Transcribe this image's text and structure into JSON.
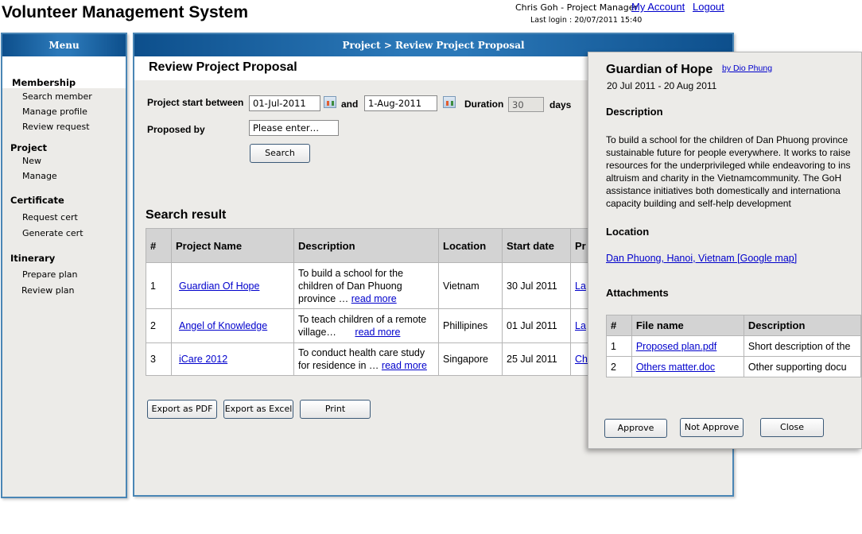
{
  "header": {
    "app_title": "Volunteer Management System",
    "user_info": "Chris Goh - Project Manager",
    "my_account": "My Account",
    "logout": "Logout",
    "last_login": "Last login : 20/07/2011 15:40"
  },
  "sidebar": {
    "title": "Menu",
    "groups": [
      {
        "label": "Membership",
        "items": [
          "Search member",
          "Manage profile",
          "Review request"
        ]
      },
      {
        "label": "Project",
        "items": [
          "New",
          "Manage"
        ]
      },
      {
        "label": "Certificate",
        "items": [
          "Request cert",
          "Generate cert"
        ]
      },
      {
        "label": "Itinerary",
        "items": [
          "Prepare plan",
          "Review plan"
        ]
      }
    ]
  },
  "main": {
    "panel_title": "Project > Review Project Proposal",
    "page_title": "Review Project Proposal",
    "form": {
      "start_between_label": "Project start between",
      "start_from": "01-Jul-2011",
      "and_label": "and",
      "start_to": "1-Aug-2011",
      "duration_label": "Duration",
      "duration_value": "30",
      "days_label": "days",
      "proposed_by_label": "Proposed by",
      "proposed_by_placeholder": "Please enter…",
      "search_button": "Search"
    },
    "results": {
      "title": "Search result",
      "columns": [
        "#",
        "Project Name",
        "Description",
        "Location",
        "Start date",
        "Pr"
      ],
      "read_more": "read more",
      "rows": [
        {
          "num": "1",
          "name": "Guardian Of Hope",
          "desc": "To build a school for the children of Dan Phuong province …",
          "location": "Vietnam",
          "start": "30 Jul 2011",
          "proposer": "La"
        },
        {
          "num": "2",
          "name": "Angel of Knowledge",
          "desc": "To teach children of a remote village…",
          "location": "Phillipines",
          "start": "01 Jul 2011",
          "proposer": "La"
        },
        {
          "num": "3",
          "name": "iCare 2012",
          "desc": "To conduct health care study for residence in …",
          "location": "Singapore",
          "start": "25 Jul 2011",
          "proposer": "Ch"
        }
      ]
    },
    "buttons": {
      "export_pdf": "Export as PDF",
      "export_excel": "Export as Excel",
      "print": "Print"
    }
  },
  "popup": {
    "title": "Guardian of Hope",
    "by": "by Dio Phung",
    "dates": "20 Jul 2011 - 20 Aug 2011",
    "description_heading": "Description",
    "description_lines": [
      "To build a school for the children of Dan Phuong province",
      "sustainable future for people everywhere. It works to raise",
      "resources for the underprivileged while endeavoring to ins",
      "altruism and charity in the Vietnamcommunity. The GoH",
      "assistance initiatives both domestically and internationa",
      "capacity building and self-help development"
    ],
    "location_heading": "Location",
    "location_link": "Dan Phuong, Hanoi, Vietnam [Google map]",
    "attachments_heading": "Attachments",
    "attachment_columns": [
      "#",
      "File name",
      "Description"
    ],
    "attachments": [
      {
        "num": "1",
        "file": "Proposed plan.pdf",
        "desc": "Short description of the"
      },
      {
        "num": "2",
        "file": "Others matter.doc",
        "desc": "Other supporting docu"
      }
    ],
    "buttons": {
      "approve": "Approve",
      "not_approve": "Not Approve",
      "close": "Close"
    }
  },
  "colors": {
    "panel_header": "#2b78b8",
    "panel_border": "#4a86b5",
    "panel_bg": "#ecebe8",
    "link": "#0000cc"
  }
}
